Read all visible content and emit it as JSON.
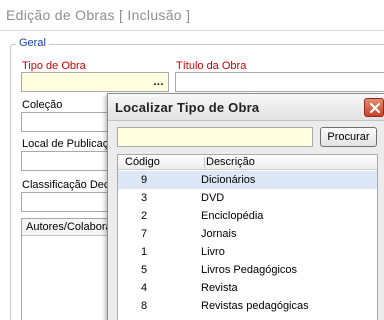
{
  "window": {
    "title": "Edição de Obras [ Inclusão ]"
  },
  "form": {
    "group_label": "Geral",
    "tipo_label": "Tipo de Obra",
    "tipo_button": "...",
    "titulo_label": "Título da Obra",
    "colecao_label": "Coleção",
    "local_label": "Local de Publicação",
    "classificacao_label": "Classificação Decimal",
    "autores_header": "Autores/Colaboradores"
  },
  "dialog": {
    "title": "Localizar Tipo de Obra",
    "search_value": "",
    "search_button": "Procurar",
    "columns": {
      "code": "Código",
      "description": "Descrição"
    },
    "rows": [
      {
        "code": "9",
        "description": "Dicionários"
      },
      {
        "code": "3",
        "description": "DVD"
      },
      {
        "code": "2",
        "description": "Enciclopédia"
      },
      {
        "code": "7",
        "description": "Jornais"
      },
      {
        "code": "1",
        "description": "Livro"
      },
      {
        "code": "5",
        "description": "Livros Pedagógicos"
      },
      {
        "code": "4",
        "description": "Revista"
      },
      {
        "code": "8",
        "description": "Revistas pedagógicas"
      }
    ]
  }
}
